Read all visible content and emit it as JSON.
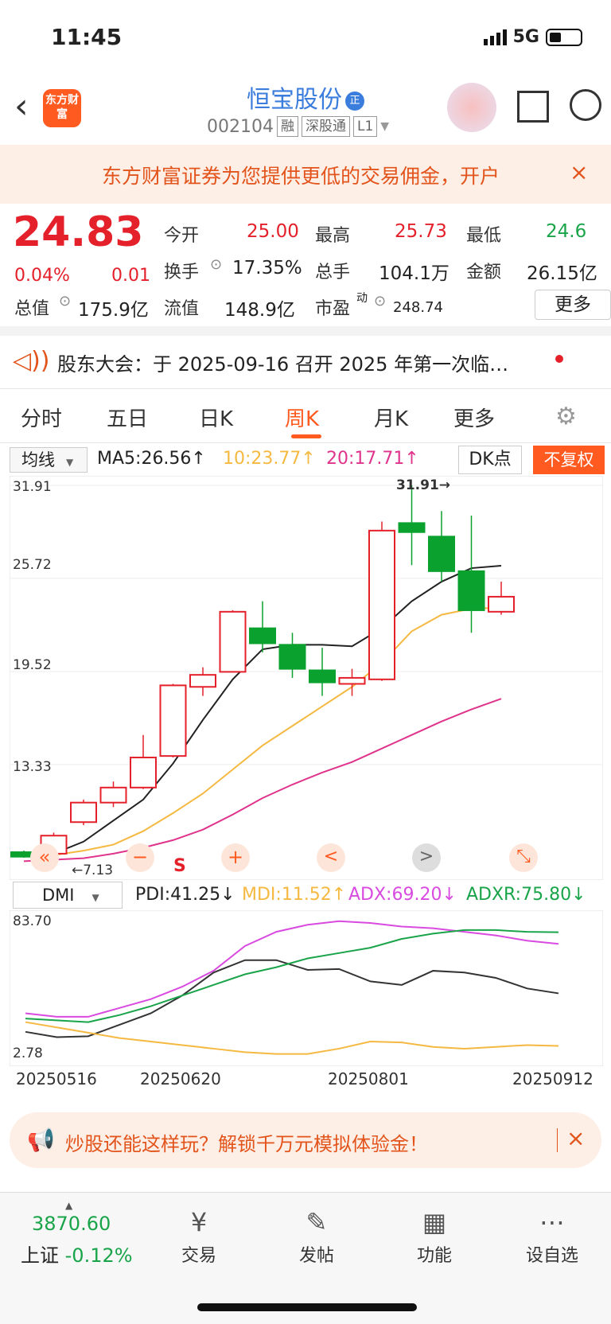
{
  "status": {
    "time": "11:45",
    "network": "5G"
  },
  "header": {
    "logo_text": "东方财富",
    "title": "恒宝股份",
    "title_badge": "正",
    "code": "002104",
    "tags": [
      "融",
      "深股通",
      "L1"
    ]
  },
  "banner": {
    "text": "东方财富证券为您提供更低的交易佣金，开户",
    "close": "×"
  },
  "quote": {
    "price": "24.83",
    "change_pct": "0.04%",
    "change": "0.01",
    "fields": [
      {
        "label": "今开",
        "value": "25.00"
      },
      {
        "label": "最高",
        "value": "25.73"
      },
      {
        "label": "最低",
        "value": "24.6"
      },
      {
        "label": "换手",
        "value": "17.35%"
      },
      {
        "label": "总手",
        "value": "104.1万"
      },
      {
        "label": "金额",
        "value": "26.15亿"
      },
      {
        "label": "总值",
        "value": "175.9亿"
      },
      {
        "label": "流值",
        "value": "148.9亿"
      },
      {
        "label": "市盈",
        "sup": "动",
        "value": "248.74"
      }
    ],
    "more_btn": "更多"
  },
  "notice": {
    "text": "股东大会：于 2025-09-16 召开 2025 年第一次临…"
  },
  "tabs": [
    "分时",
    "五日",
    "日K",
    "周K",
    "月K",
    "更多"
  ],
  "ma": {
    "select": "均线",
    "ma5": "MA5:26.56↑",
    "ma10": "10:23.77↑",
    "ma20": "20:17.71↑",
    "dk_btn": "DK点",
    "adjust_btn": "不复权"
  },
  "colors": {
    "up": "#e4212b",
    "down": "#0aa12f",
    "ma5": "#222222",
    "ma10": "#f5b942",
    "ma20": "#e0338c",
    "accent": "#ff5a1f"
  },
  "chart_data": [
    {
      "type": "candlestick",
      "y_ticks": [
        "31.91",
        "25.72",
        "19.52",
        "13.33"
      ],
      "ylim": [
        7.13,
        31.91
      ],
      "max_label": "31.91→",
      "min_label": "←7.13",
      "candles": [
        {
          "o": 7.5,
          "c": 7.2,
          "h": 7.6,
          "l": 7.13
        },
        {
          "o": 7.4,
          "c": 8.6,
          "h": 8.8,
          "l": 7.3
        },
        {
          "o": 9.5,
          "c": 10.8,
          "h": 11.0,
          "l": 9.3
        },
        {
          "o": 10.8,
          "c": 11.8,
          "h": 12.2,
          "l": 10.5
        },
        {
          "o": 11.8,
          "c": 13.8,
          "h": 15.3,
          "l": 11.7
        },
        {
          "o": 13.9,
          "c": 18.6,
          "h": 18.7,
          "l": 13.8
        },
        {
          "o": 18.5,
          "c": 19.3,
          "h": 19.8,
          "l": 17.9
        },
        {
          "o": 19.5,
          "c": 23.5,
          "h": 23.6,
          "l": 19.5
        },
        {
          "o": 22.4,
          "c": 21.4,
          "h": 24.2,
          "l": 20.8
        },
        {
          "o": 21.3,
          "c": 19.7,
          "h": 22.1,
          "l": 19.1
        },
        {
          "o": 19.6,
          "c": 18.8,
          "h": 21.1,
          "l": 17.9
        },
        {
          "o": 18.7,
          "c": 19.1,
          "h": 19.7,
          "l": 17.9
        },
        {
          "o": 19.0,
          "c": 28.9,
          "h": 29.5,
          "l": 18.9
        },
        {
          "o": 29.4,
          "c": 28.8,
          "h": 31.91,
          "l": 26.6
        },
        {
          "o": 28.5,
          "c": 26.2,
          "h": 30.2,
          "l": 25.5
        },
        {
          "o": 26.2,
          "c": 23.6,
          "h": 29.9,
          "l": 22.1
        },
        {
          "o": 23.5,
          "c": 24.5,
          "h": 25.5,
          "l": 23.3
        }
      ],
      "series": [
        {
          "name": "MA5",
          "values": [
            7.3,
            7.4,
            8.2,
            9.6,
            11.0,
            13.4,
            16.3,
            19.0,
            21.0,
            21.3,
            21.3,
            21.2,
            22.4,
            24.2,
            25.5,
            26.4,
            26.56
          ]
        },
        {
          "name": "MA10",
          "values": [
            7.2,
            7.3,
            7.6,
            8.0,
            8.9,
            10.1,
            11.4,
            13.0,
            14.6,
            15.9,
            17.2,
            18.5,
            20.1,
            22.2,
            23.3,
            23.7,
            23.77
          ]
        },
        {
          "name": "MA20",
          "values": [
            6.9,
            7.0,
            7.1,
            7.4,
            7.8,
            8.3,
            9.0,
            10.0,
            11.1,
            12.0,
            12.8,
            13.5,
            14.4,
            15.3,
            16.2,
            17.0,
            17.71
          ]
        }
      ]
    },
    {
      "type": "line",
      "indicator": "DMI",
      "ylim": [
        2.78,
        83.7
      ],
      "y_ticks": [
        "83.70",
        "2.78"
      ],
      "x": [
        "20250516",
        "20250620",
        "20250801",
        "20250912"
      ],
      "series": [
        {
          "name": "PDI",
          "values": [
            19.5,
            16.5,
            17.0,
            23.5,
            30.0,
            40.0,
            53.0,
            60.0,
            60.0,
            54.5,
            55.0,
            48.0,
            46.0,
            54.0,
            53.0,
            50.0,
            44.0,
            41.25
          ]
        },
        {
          "name": "MDI",
          "values": [
            25.0,
            22.0,
            19.0,
            16.0,
            14.0,
            12.0,
            10.0,
            8.0,
            7.0,
            7.0,
            10.0,
            14.0,
            13.5,
            11.0,
            10.0,
            11.0,
            12.0,
            11.52
          ]
        },
        {
          "name": "ADX",
          "values": [
            30.0,
            28.0,
            28.0,
            33.0,
            38.0,
            45.0,
            54.0,
            68.0,
            76.0,
            80.0,
            82.0,
            81.0,
            79.0,
            78.0,
            76.0,
            74.0,
            71.0,
            69.2
          ]
        },
        {
          "name": "ADXR",
          "values": [
            27.0,
            26.0,
            25.0,
            29.0,
            34.0,
            40.0,
            46.0,
            52.0,
            56.0,
            61.0,
            64.0,
            67.0,
            72.0,
            75.0,
            77.0,
            77.0,
            76.0,
            75.8
          ]
        }
      ]
    }
  ],
  "dmi": {
    "select": "DMI",
    "pdi": "PDI:41.25↓",
    "mdi": "MDI:11.52↑",
    "adx": "ADX:69.20↓",
    "adxr": "ADXR:75.80↓"
  },
  "chart_controls": {
    "first": "«",
    "zoom_out": "−",
    "s_label": "S",
    "zoom_in": "+",
    "prev": "<",
    "next": ">",
    "expand": "⤡"
  },
  "ad": {
    "text": "炒股还能这样玩？解锁千万元模拟体验金！",
    "close": "×"
  },
  "bottom_nav": {
    "index_value": "3870.60",
    "index_label": "上证",
    "index_change": "-0.12%",
    "items": [
      {
        "label": "交易",
        "icon": "¥"
      },
      {
        "label": "发帖",
        "icon": "✎"
      },
      {
        "label": "功能",
        "icon": "▦"
      },
      {
        "label": "设自选",
        "icon": "⋯"
      }
    ]
  }
}
